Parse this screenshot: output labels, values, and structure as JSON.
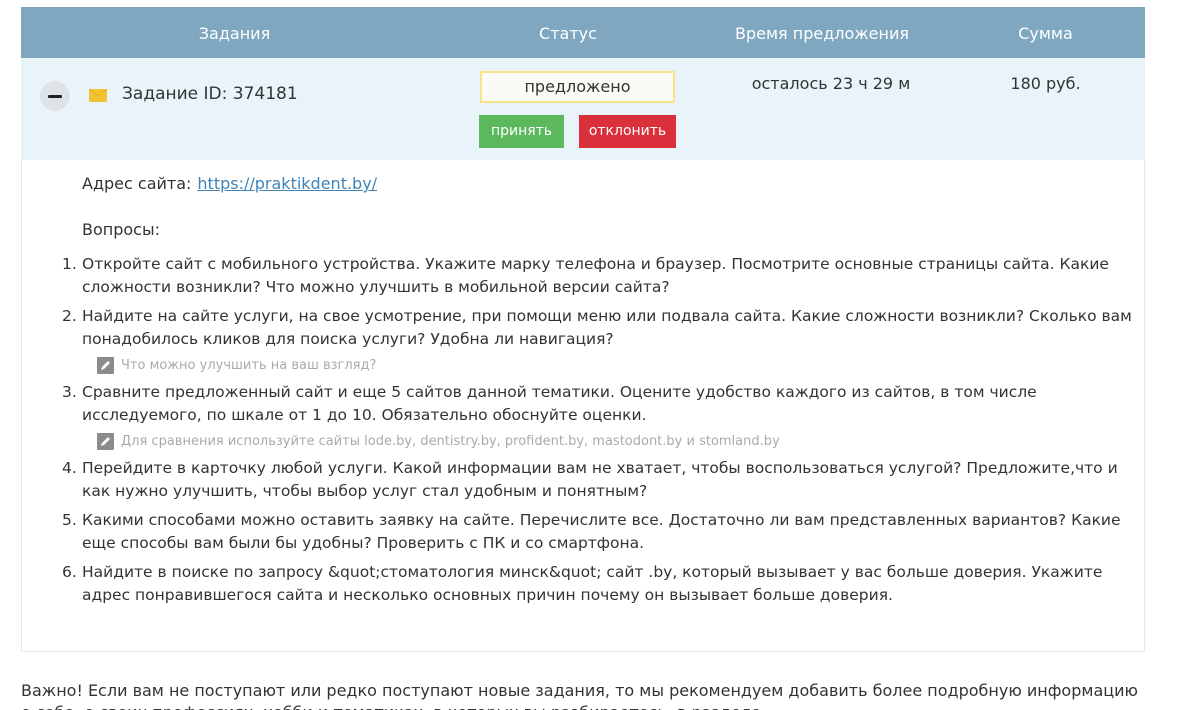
{
  "table": {
    "headers": {
      "task": "Задания",
      "status": "Статус",
      "time": "Время предложения",
      "sum": "Сумма"
    }
  },
  "task": {
    "id_label": "Задание ID: 374181",
    "status": "предложено",
    "accept_label": "принять",
    "reject_label": "отклонить",
    "time_left": "осталось 23 ч 29 м",
    "sum": "180 руб."
  },
  "details": {
    "site_label": "Адрес сайта:",
    "site_url": "https://praktikdent.by/",
    "questions_label": "Вопросы:",
    "questions": [
      {
        "num": "1.",
        "text": "Откройте сайт с мобильного устройства. Укажите марку телефона и браузер. Посмотрите основные страницы сайта. Какие сложности возникли? Что можно улучшить в мобильной версии сайта?",
        "hint": ""
      },
      {
        "num": "2.",
        "text": "Найдите на сайте услуги, на свое усмотрение, при помощи меню или подвала сайта. Какие сложности возникли? Сколько вам понадобилось кликов для поиска услуги? Удобна ли навигация?",
        "hint": "Что можно улучшить на ваш взгляд?"
      },
      {
        "num": "3.",
        "text": "Сравните предложенный сайт и еще 5 сайтов данной тематики. Оцените удобство каждого из сайтов, в том числе исследуемого, по шкале от 1 до 10. Обязательно обоснуйте оценки.",
        "hint": "Для сравнения используйте сайты lode.by, dentistry.by, profident.by, mastodont.by и stomland.by"
      },
      {
        "num": "4.",
        "text": "Перейдите в карточку любой услуги. Какой информации вам не хватает, чтобы воспользоваться услугой? Предложите,что и как нужно улучшить, чтобы выбор услуг стал удобным и понятным?",
        "hint": ""
      },
      {
        "num": "5.",
        "text": "Какими способами можно оставить заявку на сайте. Перечислите все. Достаточно ли вам представленных вариантов? Какие еще способы вам были бы удобны? Проверить с ПК и со смартфона.",
        "hint": ""
      },
      {
        "num": "6.",
        "text": "Найдите в поиске по запросу &quot;стоматология минск&quot; сайт .by, который вызывает у вас больше доверия. Укажите адрес понравившегося сайта и несколько основных причин почему он вызывает больше доверия.",
        "hint": ""
      }
    ]
  },
  "footer": {
    "note": "Важно! Если вам не поступают или редко поступают новые задания, то мы рекомендуем добавить более подробную информацию о себе, о своих профессиях, хобби и тематиках, в которых вы разбираетесь, в разделе"
  },
  "colors": {
    "header_bg": "#7fa8c0",
    "row_bg": "#e8f4f9",
    "accept": "#5cb85c",
    "reject": "#d9303c",
    "link": "#3f83b8",
    "status_border": "#f7e38a"
  }
}
